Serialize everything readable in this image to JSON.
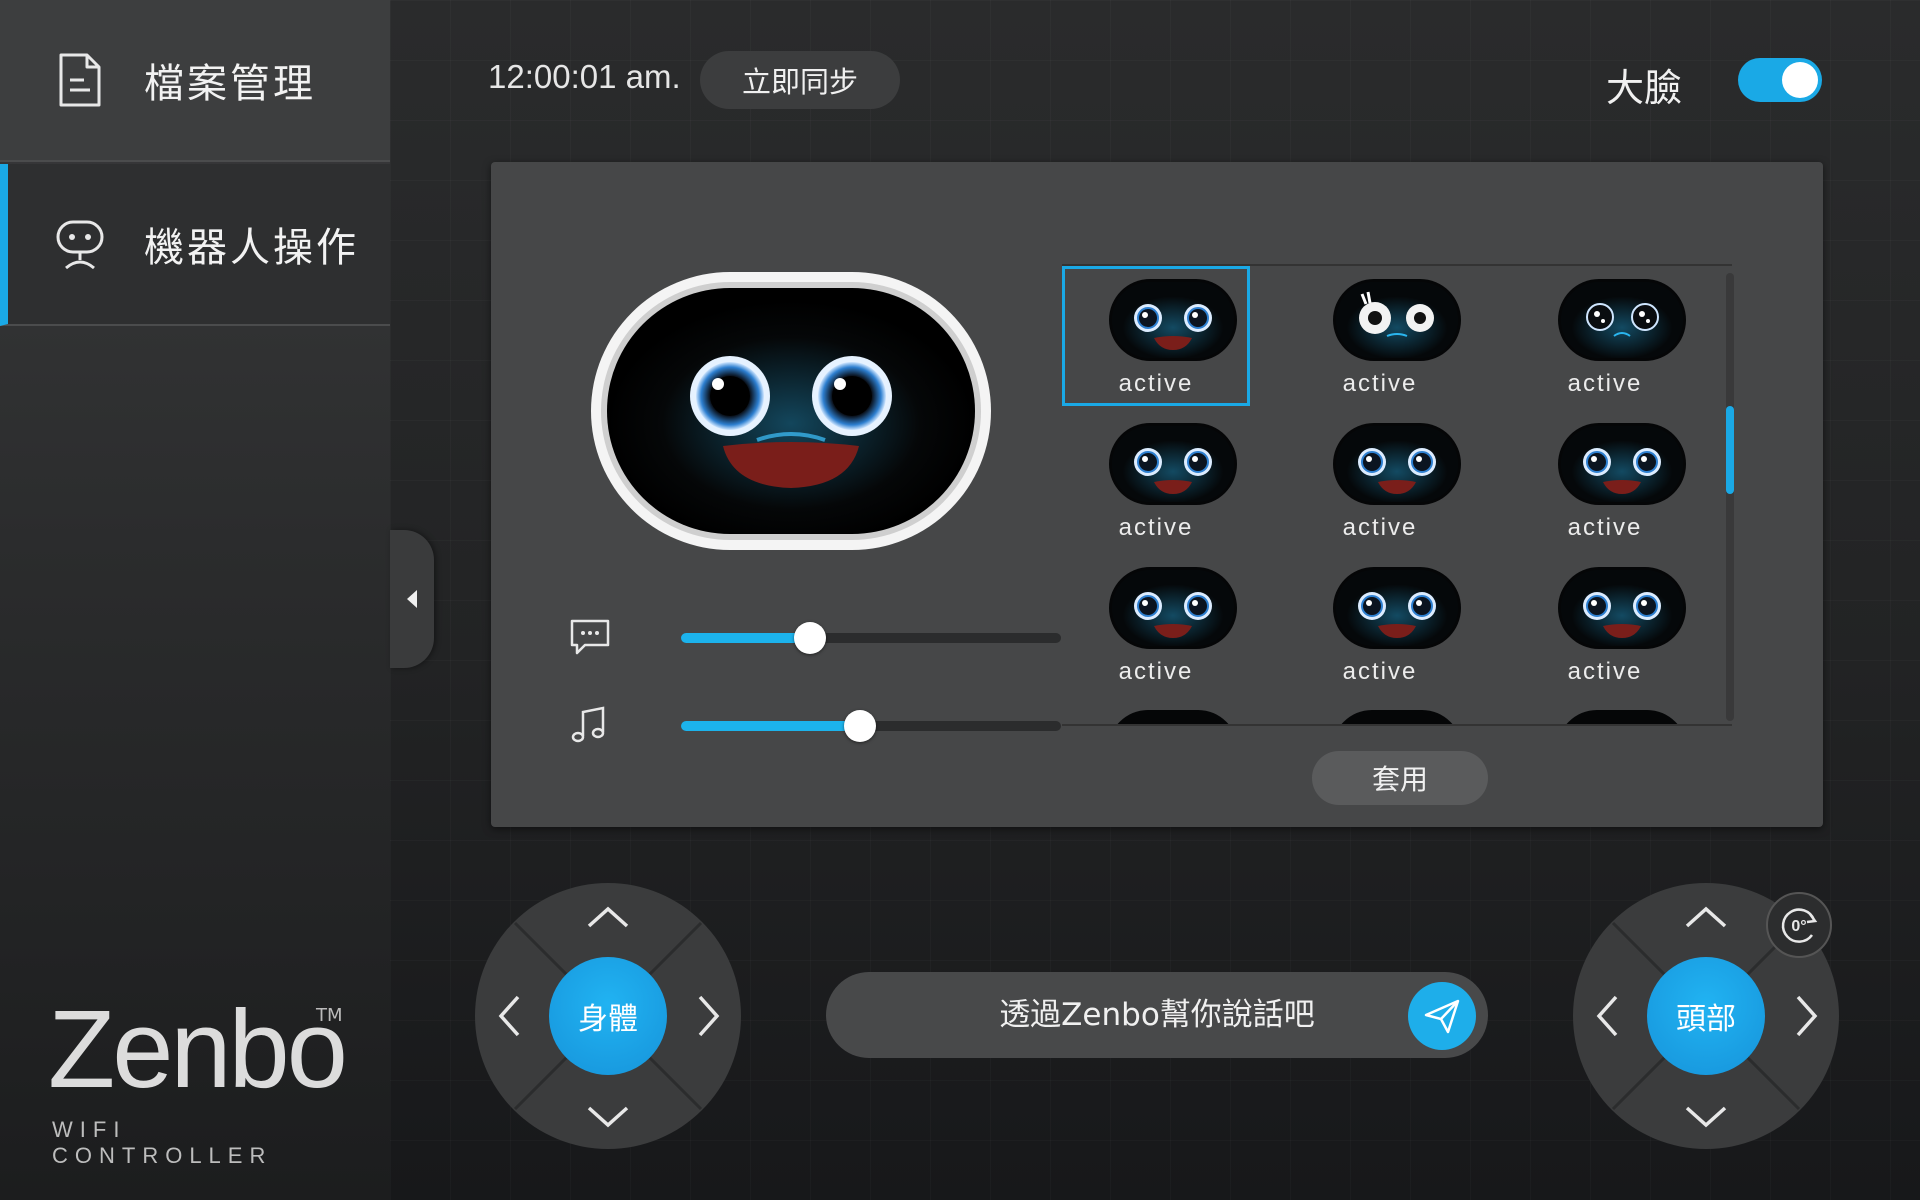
{
  "sidebar": {
    "items": [
      {
        "label": "檔案管理",
        "icon": "document-icon"
      },
      {
        "label": "機器人操作",
        "icon": "robot-face-icon"
      }
    ],
    "brand": {
      "name": "Zenbo",
      "tm": "TM",
      "subtitle": "WIFI CONTROLLER"
    }
  },
  "topbar": {
    "time": "12:00:01 am.",
    "sync_label": "立即同步",
    "bigface_label": "大臉",
    "bigface_enabled": true
  },
  "panel": {
    "preview_icon": "robot-face-preview",
    "sliders": [
      {
        "name": "speech",
        "icon": "chat-bubble-icon",
        "value": 0.34
      },
      {
        "name": "music",
        "icon": "music-note-icon",
        "value": 0.47
      }
    ],
    "faces": [
      {
        "label": "active",
        "variant": "smile",
        "selected": true
      },
      {
        "label": "active",
        "variant": "surprised",
        "selected": false
      },
      {
        "label": "active",
        "variant": "sparkle",
        "selected": false
      },
      {
        "label": "active",
        "variant": "smile",
        "selected": false
      },
      {
        "label": "active",
        "variant": "smile",
        "selected": false
      },
      {
        "label": "active",
        "variant": "smile",
        "selected": false
      },
      {
        "label": "active",
        "variant": "smile",
        "selected": false
      },
      {
        "label": "active",
        "variant": "smile",
        "selected": false
      },
      {
        "label": "active",
        "variant": "smile",
        "selected": false
      }
    ],
    "scroll_position": 0.37,
    "apply_label": "套用"
  },
  "controls": {
    "body_label": "身體",
    "head_label": "頭部",
    "rotate_label": "0°",
    "speak_placeholder": "透過Zenbo幫你說話吧"
  },
  "colors": {
    "accent": "#1aa9e6",
    "panel": "#464748",
    "sidebar": "#3d3e3f"
  }
}
